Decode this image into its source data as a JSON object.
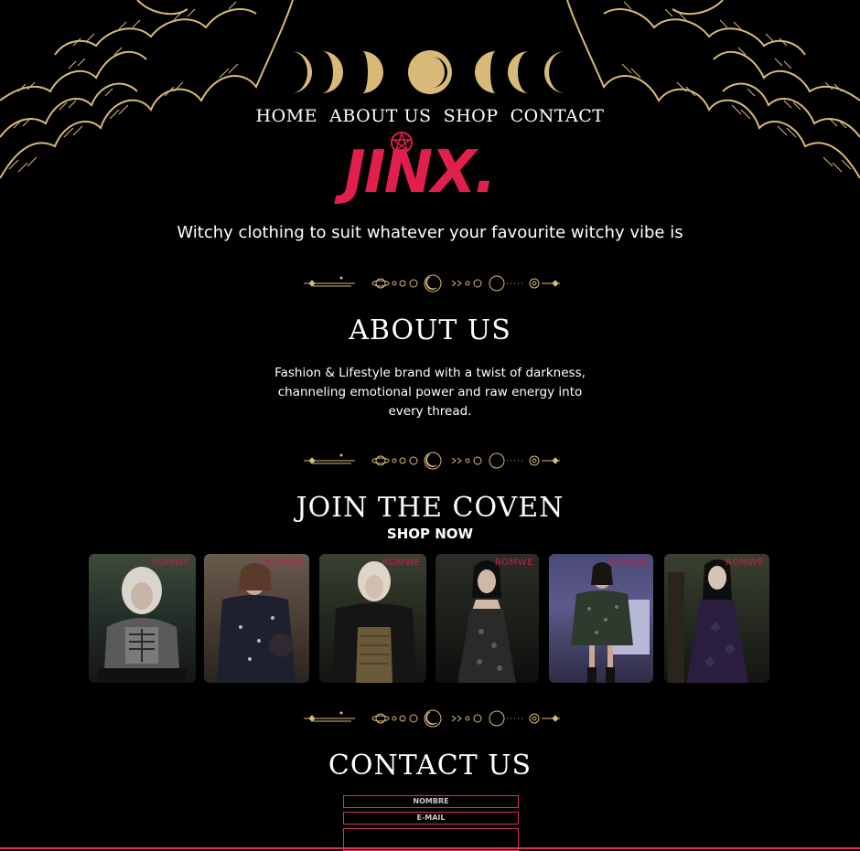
{
  "nav": {
    "items": [
      "HOME",
      "ABOUT US",
      "SHOP",
      "CONTACT"
    ]
  },
  "logo": {
    "text": "JINX."
  },
  "tagline": "Witchy clothing to suit whatever your favourite witchy vibe is",
  "about": {
    "title": "ABOUT US",
    "text": "Fashion & Lifestyle brand with a twist of darkness, channeling emotional power and raw energy into every thread."
  },
  "shop": {
    "title": "JOIN THE COVEN",
    "cta": "SHOP NOW",
    "products": [
      {
        "brand": "ROMWE",
        "icon": "skeleton-top-photo"
      },
      {
        "brand": "ROMWE",
        "icon": "celestial-dress-photo"
      },
      {
        "brand": "ROMWE",
        "icon": "corset-blouse-photo"
      },
      {
        "brand": "ROMWE",
        "icon": "slip-dress-photo"
      },
      {
        "brand": "ROMWE",
        "icon": "offshoulder-dress-photo"
      },
      {
        "brand": "ROMWE",
        "icon": "velvet-slip-dress-photo"
      }
    ]
  },
  "contact": {
    "title": "CONTACT US",
    "name_placeholder": "NOMBRE",
    "email_placeholder": "E-MAIL"
  },
  "colors": {
    "background": "#000000",
    "gold": "#d8b977",
    "brand_red": "#e01f4c",
    "border_pink": "#d6325a"
  }
}
